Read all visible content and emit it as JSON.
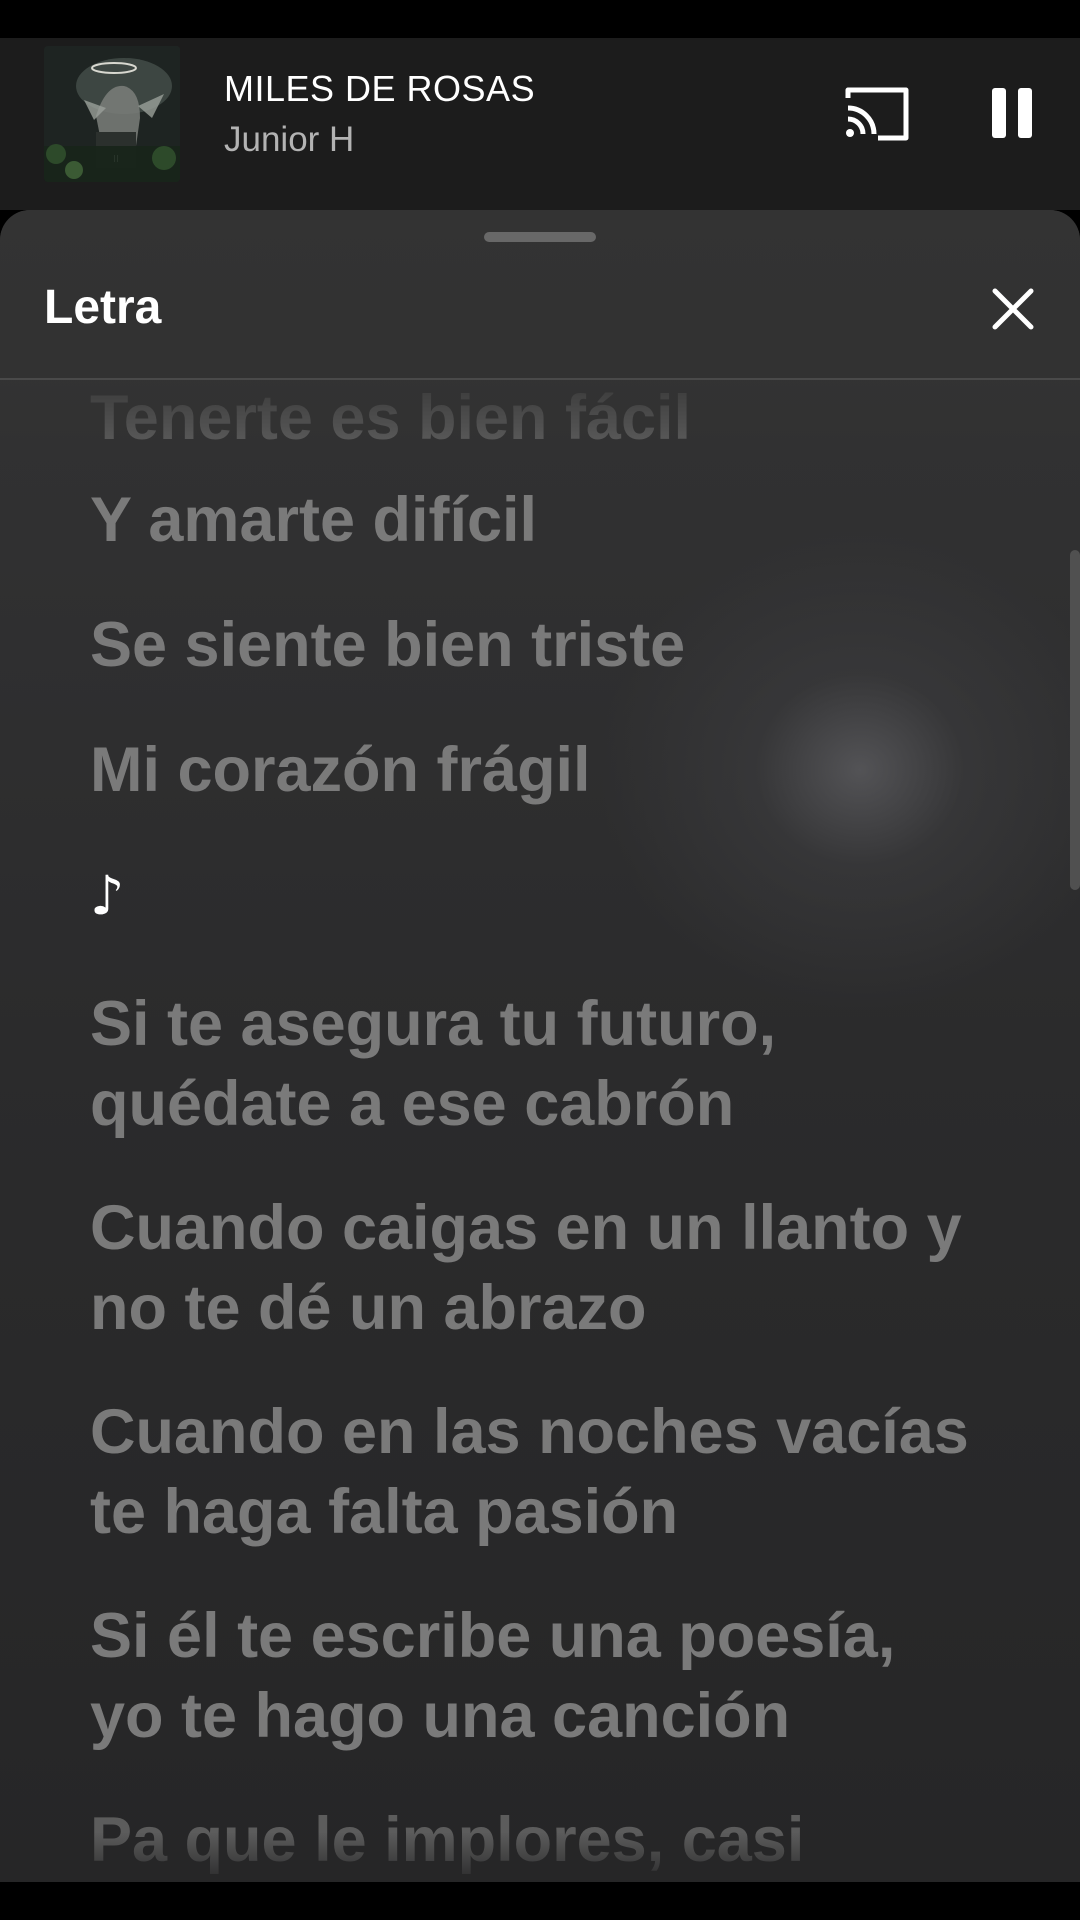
{
  "now_playing": {
    "title": "MILES DE ROSAS",
    "artist": "Junior H",
    "cast_icon": "cast-icon",
    "pause_icon": "pause-icon"
  },
  "lyrics_sheet": {
    "title": "Letra",
    "close_icon": "close-icon",
    "lines": [
      "Tenerte es bien fácil",
      "Y amarte difícil",
      "Se siente bien triste",
      "Mi corazón frágil",
      "♪",
      "Si te asegura tu futuro,\nquédate a ese cabrón",
      "Cuando caigas en un llanto y\nno te dé un abrazo",
      "Cuando en las noches vacías\nte haga falta pasión",
      "Si él te escribe una poesía,\nyo te hago una canción",
      "Pa que le implores, casi"
    ],
    "active_line": 4
  },
  "colors": {
    "background": "#000000",
    "mini_player": "#1c1c1c",
    "sheet": "#2f2f30",
    "lyric_inactive": "#7a7a7a",
    "lyric_active": "#ffffff"
  }
}
